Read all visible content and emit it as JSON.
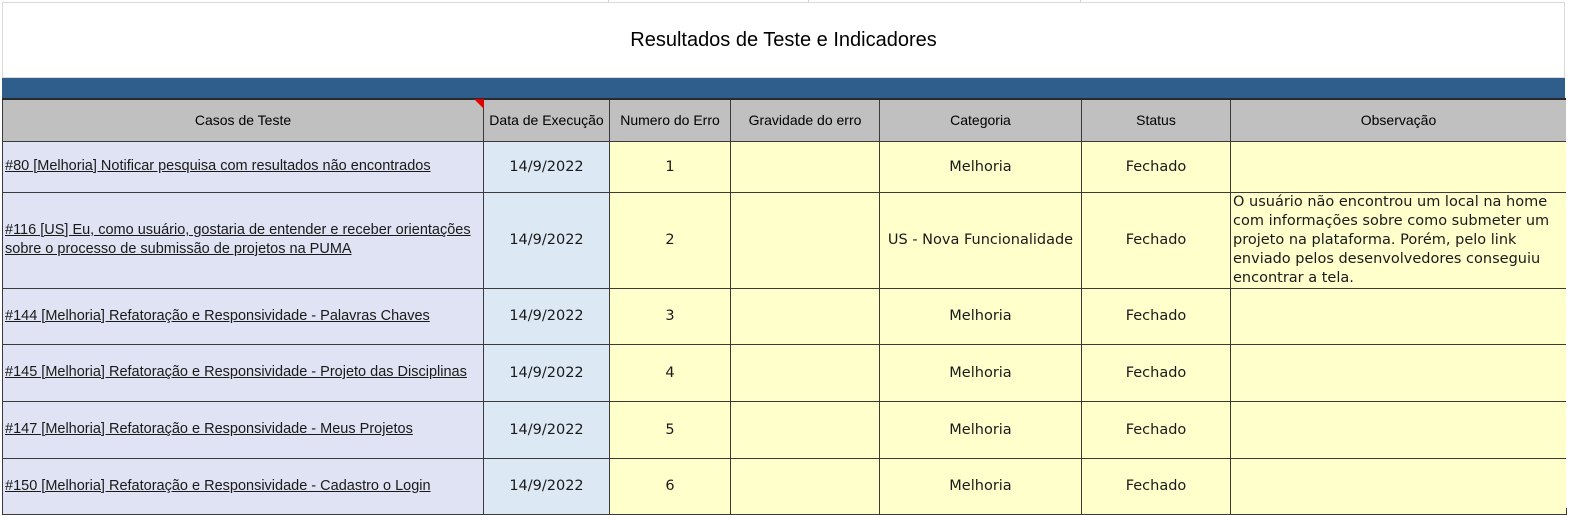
{
  "title": "Resultados de Teste e Indicadores",
  "colors": {
    "band": "#2f5d8c",
    "header_bg": "#c0c0c0",
    "case_bg": "#dfe3f3",
    "date_bg": "#dde8f5",
    "cell_bg": "#ffffcc",
    "comment_flag": "#e00000"
  },
  "headers": {
    "casos": "Casos de Teste",
    "data": "Data de Execução",
    "numero": "Numero do Erro",
    "gravidade": "Gravidade do erro",
    "categoria": "Categoria",
    "status": "Status",
    "observacao": "Observação"
  },
  "rows": [
    {
      "caso": "#80 [Melhoria] Notificar pesquisa com resultados não encontrados",
      "data": "14/9/2022",
      "numero": "1",
      "gravidade": "",
      "categoria": "Melhoria",
      "status": "Fechado",
      "observacao": ""
    },
    {
      "caso": "#116 [US] Eu, como usuário, gostaria de entender e receber orientações sobre o processo de submissão de projetos na PUMA",
      "data": "14/9/2022",
      "numero": "2",
      "gravidade": "",
      "categoria": "US - Nova Funcionalidade",
      "status": "Fechado",
      "observacao": "O usuário não encontrou um local na home com informações sobre como submeter um projeto na plataforma. Porém, pelo link enviado pelos desenvolvedores conseguiu encontrar a tela."
    },
    {
      "caso": "#144 [Melhoria] Refatoração e Responsividade - Palavras Chaves",
      "data": "14/9/2022",
      "numero": "3",
      "gravidade": "",
      "categoria": "Melhoria",
      "status": "Fechado",
      "observacao": ""
    },
    {
      "caso": "#145 [Melhoria] Refatoração e Responsividade - Projeto das Disciplinas",
      "data": "14/9/2022",
      "numero": "4",
      "gravidade": "",
      "categoria": "Melhoria",
      "status": "Fechado",
      "observacao": ""
    },
    {
      "caso": "#147 [Melhoria] Refatoração e Responsividade - Meus Projetos",
      "data": "14/9/2022",
      "numero": "5",
      "gravidade": "",
      "categoria": "Melhoria",
      "status": "Fechado",
      "observacao": ""
    },
    {
      "caso": "#150 [Melhoria] Refatoração e Responsividade - Cadastro o Login",
      "data": "14/9/2022",
      "numero": "6",
      "gravidade": "",
      "categoria": "Melhoria",
      "status": "Fechado",
      "observacao": ""
    }
  ]
}
